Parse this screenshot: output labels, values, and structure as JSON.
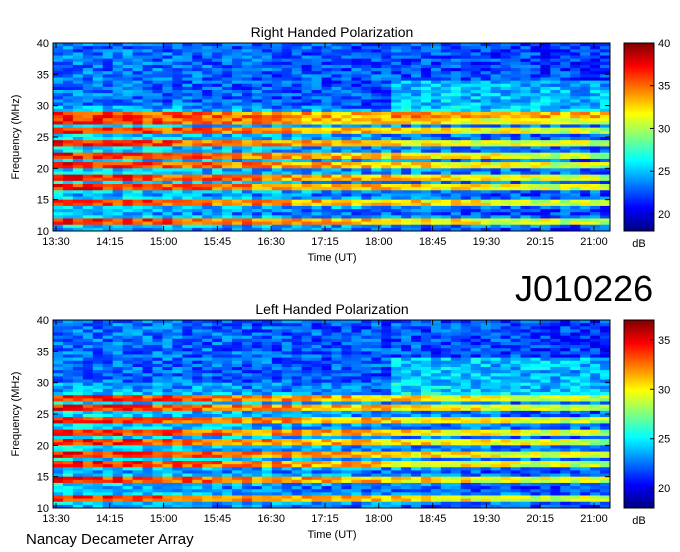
{
  "header": {
    "observation_id": "J010226"
  },
  "footer": {
    "instrument": "Nancay Decameter Array"
  },
  "chart_data": [
    {
      "type": "heatmap",
      "title": "Right Handed Polarization",
      "xlabel": "Time (UT)",
      "ylabel": "Frequency (MHz)",
      "x_ticks": [
        "13:30",
        "14:15",
        "15:00",
        "15:45",
        "16:30",
        "17:15",
        "18:00",
        "18:45",
        "19:30",
        "20:15",
        "21:00"
      ],
      "y_ticks": [
        10,
        15,
        20,
        25,
        30,
        35,
        40
      ],
      "ylim": [
        10,
        40
      ],
      "colorbar": {
        "label": "dB",
        "ticks": [
          20,
          25,
          30,
          35,
          40
        ],
        "range": [
          18,
          40
        ]
      },
      "emission_bands_mhz": [
        11.5,
        14.5,
        17,
        18.5,
        20.5,
        22,
        24,
        26,
        27.5,
        28.5
      ],
      "colormap": [
        "#00007f",
        "#0000ff",
        "#007fff",
        "#00ffff",
        "#7fff7f",
        "#ffff00",
        "#ff7f00",
        "#ff0000",
        "#7f0000"
      ]
    },
    {
      "type": "heatmap",
      "title": "Left Handed Polarization",
      "xlabel": "Time (UT)",
      "ylabel": "Frequency (MHz)",
      "x_ticks": [
        "13:30",
        "14:15",
        "15:00",
        "15:45",
        "16:30",
        "17:15",
        "18:00",
        "18:45",
        "19:30",
        "20:15",
        "21:00"
      ],
      "y_ticks": [
        10,
        15,
        20,
        25,
        30,
        35,
        40
      ],
      "ylim": [
        10,
        40
      ],
      "colorbar": {
        "label": "dB",
        "ticks": [
          20,
          25,
          30,
          35
        ],
        "range": [
          18,
          37
        ]
      },
      "emission_bands_mhz": [
        11.5,
        14.5,
        17,
        18.5,
        20.5,
        22,
        24,
        26,
        27.5
      ],
      "colormap": [
        "#00007f",
        "#0000ff",
        "#007fff",
        "#00ffff",
        "#7fff7f",
        "#ffff00",
        "#ff7f00",
        "#ff0000",
        "#7f0000"
      ]
    }
  ]
}
